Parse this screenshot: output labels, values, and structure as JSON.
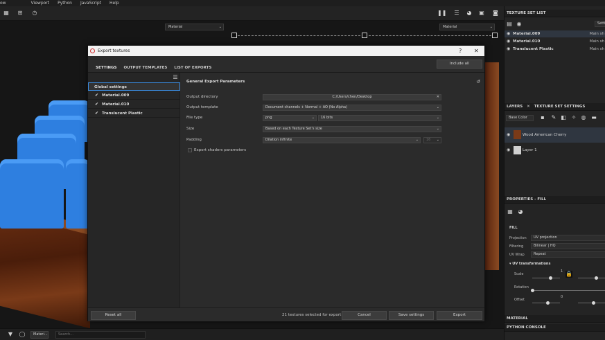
{
  "menu": [
    "ow",
    "Edit",
    "Viewport",
    "Python",
    "JavaScript",
    "Help"
  ],
  "viewport": {
    "left_select": "Material",
    "right_select": "Material"
  },
  "dialog": {
    "title": "Export textures",
    "help": "?",
    "close": "✕",
    "tabs": [
      "SETTINGS",
      "OUTPUT TEMPLATES",
      "LIST OF EXPORTS"
    ],
    "include_all": "Include all",
    "list": {
      "header": "Global settings",
      "items": [
        "Material.009",
        "Material.010",
        "Translucent Plastic"
      ]
    },
    "section_title": "General Export Parameters",
    "fields": {
      "output_directory_label": "Output directory",
      "output_directory_value": "C:/Users/chen/Desktop",
      "output_template_label": "Output template",
      "output_template_value": "Document channels + Normal + AO (No Alpha)",
      "file_type_label": "File type",
      "file_type_value": "png",
      "bit_depth_value": "16 bits",
      "size_label": "Size",
      "size_value": "Based on each Texture Set's size",
      "padding_label": "Padding",
      "padding_value": "Dilation infinite",
      "padding_extra": "16",
      "export_shaders_label": "Export shaders parameters"
    },
    "footer": {
      "reset_all": "Reset all",
      "status": "21 textures selected for export",
      "cancel": "Cancel",
      "save_settings": "Save settings",
      "export": "Export"
    }
  },
  "right_panel": {
    "texture_set_list_title": "TEXTURE SET LIST",
    "settings_btn": "Setti",
    "texture_sets": [
      {
        "name": "Material.009",
        "shader": "Main sh"
      },
      {
        "name": "Material.010",
        "shader": "Main sh"
      },
      {
        "name": "Translucent Plastic",
        "shader": "Main sh"
      }
    ],
    "layers_tab": "LAYERS",
    "texture_set_settings_tab": "TEXTURE SET SETTINGS",
    "blend_mode": "Base Color",
    "layers": [
      "Wood American Cherry",
      "Layer 1"
    ],
    "properties_title": "PROPERTIES - FILL",
    "fill_label": "FILL",
    "projection_label": "Projection",
    "projection_value": "UV projection",
    "filtering_label": "Filtering",
    "filtering_value": "Bilinear | HQ",
    "uvwrap_label": "UV Wrap",
    "uvwrap_value": "Repeat",
    "uv_transformations": "UV transformations",
    "scale_label": "Scale",
    "scale_value": "1",
    "rotation_label": "Rotation",
    "offset_label": "Offset",
    "offset_value": "0",
    "material_title": "MATERIAL",
    "python_console_title": "PYTHON CONSOLE"
  },
  "statusbar": {
    "chip": "Materi...",
    "search_placeholder": "Search..."
  },
  "colors": {
    "accent": "#3b8fe6",
    "keycap_blue": "#2e7fe0",
    "wood": "#7a3a18"
  }
}
